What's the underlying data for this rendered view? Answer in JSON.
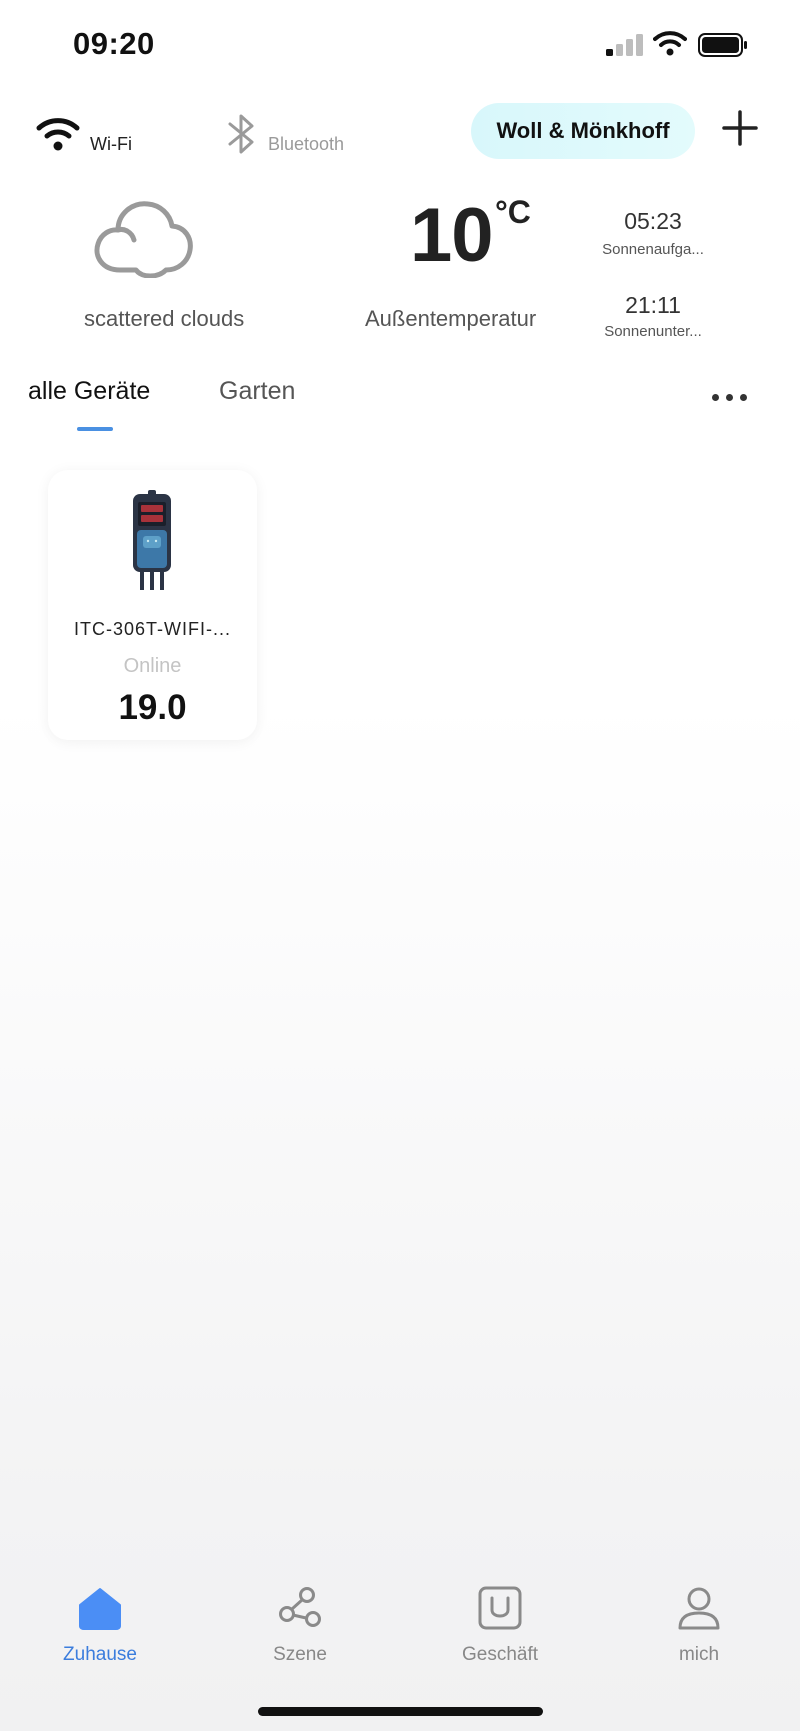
{
  "status_bar": {
    "time": "09:20",
    "signal_icon": "cellular-signal-icon",
    "wifi_icon": "wifi-icon",
    "battery_icon": "battery-icon"
  },
  "connection": {
    "wifi_label": "Wi-Fi",
    "bluetooth_label": "Bluetooth"
  },
  "home_name": "Woll & Mönkhoff",
  "weather": {
    "description": "scattered clouds",
    "temperature": "10",
    "unit": "°C",
    "temperature_label": "Außentemperatur",
    "sunrise_time": "05:23",
    "sunrise_label": "Sonnenaufga...",
    "sunset_time": "21:11",
    "sunset_label": "Sonnenunter..."
  },
  "tabs": [
    {
      "label": "alle Geräte",
      "active": true
    },
    {
      "label": "Garten",
      "active": false
    }
  ],
  "devices": [
    {
      "name": "ITC-306T-WIFI-...",
      "status": "Online",
      "value": "19.0"
    }
  ],
  "nav": [
    {
      "label": "Zuhause",
      "icon": "home-icon",
      "active": true
    },
    {
      "label": "Szene",
      "icon": "share-nodes-icon",
      "active": false
    },
    {
      "label": "Geschäft",
      "icon": "store-icon",
      "active": false
    },
    {
      "label": "mich",
      "icon": "person-icon",
      "active": false
    }
  ],
  "colors": {
    "accent": "#3b7ddd",
    "home_pill": "#dcf8fb",
    "inactive": "#888888"
  }
}
